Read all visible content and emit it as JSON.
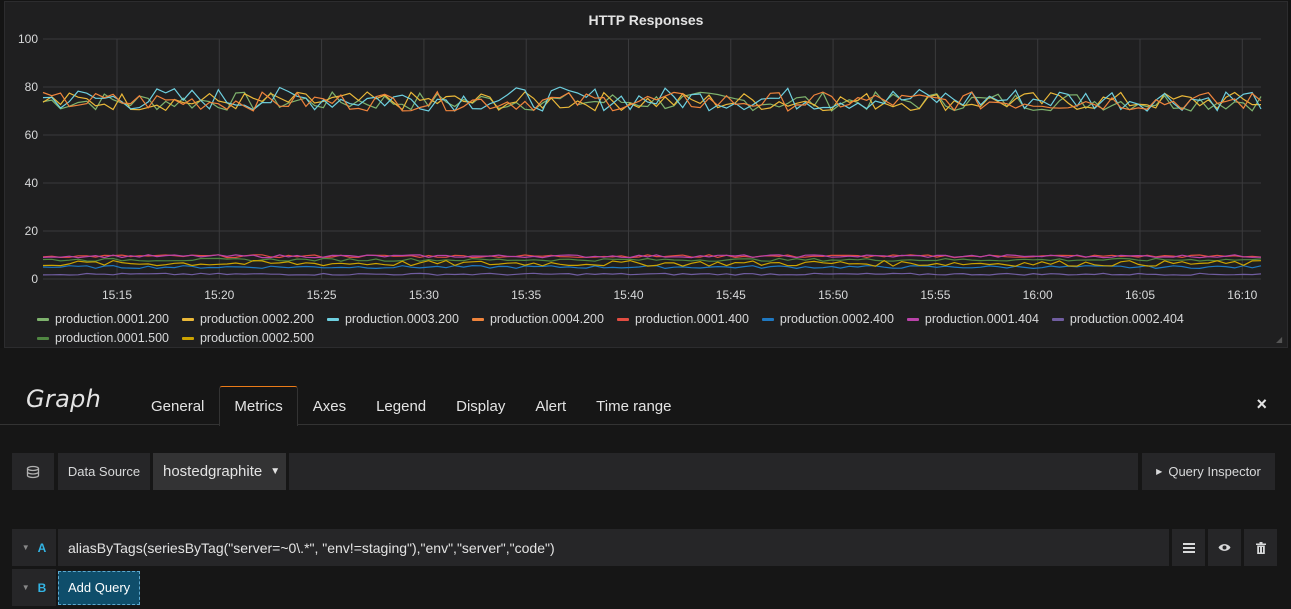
{
  "panel": {
    "title": "HTTP Responses"
  },
  "chart_data": {
    "type": "line",
    "title": "HTTP Responses",
    "ylim": [
      0,
      100
    ],
    "yticks": [
      "100",
      "80",
      "60",
      "40",
      "20",
      "0"
    ],
    "xticks": [
      "15:15",
      "15:20",
      "15:25",
      "15:30",
      "15:35",
      "15:40",
      "15:45",
      "15:50",
      "15:55",
      "16:00",
      "16:05",
      "16:10"
    ],
    "grid": true,
    "legend_position": "bottom",
    "series": [
      {
        "name": "production.0001.200",
        "color": "#7eb26d",
        "level": 74,
        "amp": 4
      },
      {
        "name": "production.0002.200",
        "color": "#eab839",
        "level": 74,
        "amp": 4
      },
      {
        "name": "production.0003.200",
        "color": "#6ed0e0",
        "level": 75,
        "amp": 5
      },
      {
        "name": "production.0004.200",
        "color": "#ef843c",
        "level": 74,
        "amp": 4
      },
      {
        "name": "production.0001.400",
        "color": "#e24d42",
        "level": 9.5,
        "amp": 0.6
      },
      {
        "name": "production.0002.400",
        "color": "#1f78c1",
        "level": 5,
        "amp": 0.6
      },
      {
        "name": "production.0001.404",
        "color": "#ba43a9",
        "level": 9.5,
        "amp": 0.6
      },
      {
        "name": "production.0002.404",
        "color": "#705da0",
        "level": 2,
        "amp": 0.4
      },
      {
        "name": "production.0001.500",
        "color": "#508642",
        "level": 8,
        "amp": 0.6
      },
      {
        "name": "production.0002.500",
        "color": "#cca300",
        "level": 6.5,
        "amp": 1.2
      }
    ]
  },
  "editor": {
    "title": "Graph",
    "tabs": [
      "General",
      "Metrics",
      "Axes",
      "Legend",
      "Display",
      "Alert",
      "Time range"
    ],
    "active_tab": "Metrics",
    "close_icon": "×"
  },
  "datasource": {
    "label": "Data Source",
    "value": "hostedgraphite",
    "inspector_label": "Query Inspector"
  },
  "queries": [
    {
      "letter": "A",
      "expression": "aliasByTags(seriesByTag(\"server=~0\\.*\", \"env!=staging\"),\"env\",\"server\",\"code\")"
    },
    {
      "letter": "B"
    }
  ],
  "add_query_label": "Add Query"
}
